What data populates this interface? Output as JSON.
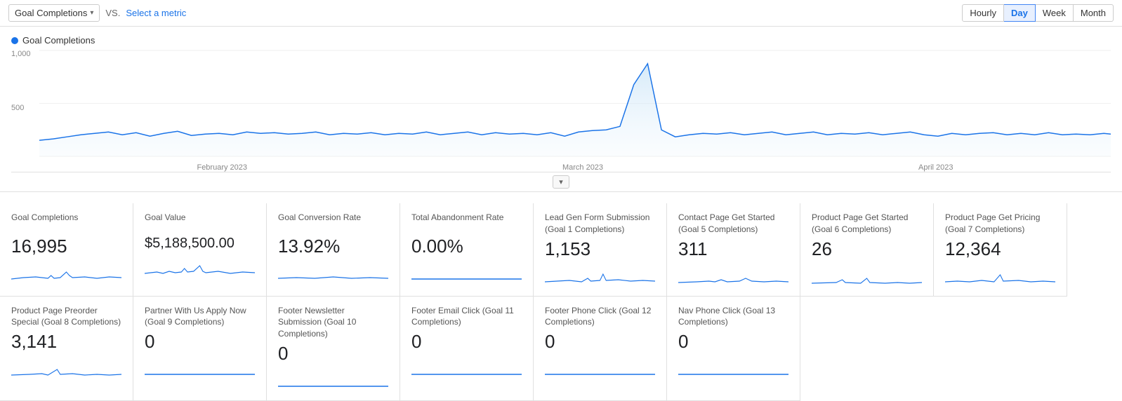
{
  "toolbar": {
    "metric_label": "Goal Completions",
    "vs_label": "VS.",
    "select_metric_label": "Select a metric",
    "time_buttons": [
      "Hourly",
      "Day",
      "Week",
      "Month"
    ],
    "active_time": "Day"
  },
  "chart": {
    "legend_label": "Goal Completions",
    "y_axis": [
      "1,000",
      "500",
      ""
    ],
    "x_axis": [
      "February 2023",
      "March 2023",
      "April 2023"
    ]
  },
  "metrics_row1": [
    {
      "title": "Goal Completions",
      "value": "16,995"
    },
    {
      "title": "Goal Value",
      "value": "$5,188,500.00"
    },
    {
      "title": "Goal Conversion Rate",
      "value": "13.92%"
    },
    {
      "title": "Total Abandonment Rate",
      "value": "0.00%"
    },
    {
      "title": "Lead Gen Form Submission (Goal 1 Completions)",
      "value": "1,153"
    },
    {
      "title": "Contact Page Get Started (Goal 5 Completions)",
      "value": "311"
    },
    {
      "title": "Product Page Get Started (Goal 6 Completions)",
      "value": "26"
    },
    {
      "title": "Product Page Get Pricing (Goal 7 Completions)",
      "value": "12,364"
    }
  ],
  "metrics_row2": [
    {
      "title": "Product Page Preorder Special (Goal 8 Completions)",
      "value": "3,141"
    },
    {
      "title": "Partner With Us Apply Now (Goal 9 Completions)",
      "value": "0"
    },
    {
      "title": "Footer Newsletter Submission (Goal 10 Completions)",
      "value": "0"
    },
    {
      "title": "Footer Email Click (Goal 11 Completions)",
      "value": "0"
    },
    {
      "title": "Footer Phone Click (Goal 12 Completions)",
      "value": "0"
    },
    {
      "title": "Nav Phone Click (Goal 13 Completions)",
      "value": "0"
    }
  ],
  "colors": {
    "accent": "#1a73e8",
    "chart_fill": "#e8f4fd",
    "chart_stroke": "#1a73e8"
  }
}
